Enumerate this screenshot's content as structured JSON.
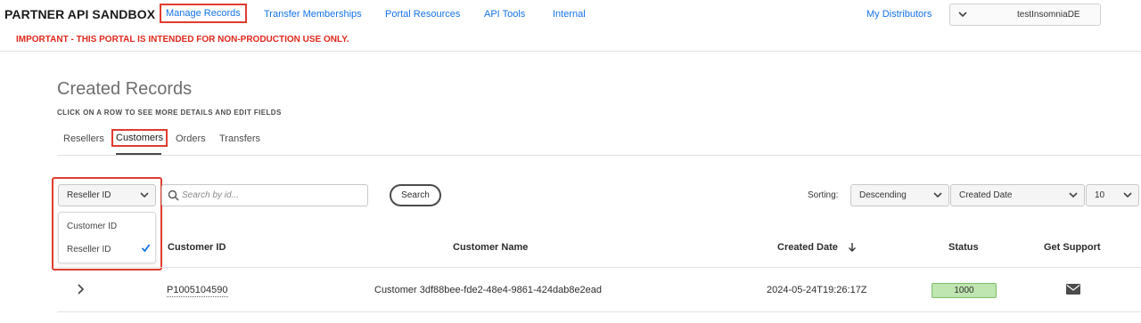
{
  "header": {
    "brand": "PARTNER API SANDBOX",
    "nav": [
      "Manage Records",
      "Transfer Memberships",
      "Portal Resources",
      "API Tools",
      "Internal"
    ],
    "my_distributors": "My Distributors",
    "distributor_value": "testInsomniaDE",
    "warning": "IMPORTANT - THIS PORTAL IS INTENDED FOR NON-PRODUCTION USE ONLY."
  },
  "page": {
    "title": "Created Records",
    "subtitle": "CLICK ON A ROW TO SEE MORE DETAILS AND EDIT FIELDS"
  },
  "tabs": [
    "Resellers",
    "Customers",
    "Orders",
    "Transfers"
  ],
  "active_tab": "Customers",
  "filter": {
    "selected": "Reseller ID",
    "options": [
      "Customer ID",
      "Reseller ID"
    ],
    "search_placeholder": "Search by id...",
    "search_button": "Search"
  },
  "sorting": {
    "label": "Sorting:",
    "direction": "Descending",
    "field": "Created Date",
    "page_size": "10"
  },
  "table": {
    "columns": [
      "Customer ID",
      "Customer Name",
      "Created Date",
      "Status",
      "Get Support"
    ],
    "rows": [
      {
        "customer_id": "P1005104590",
        "customer_name": "Customer 3df88bee-fde2-48e4-9861-424dab8e2ead",
        "created_date": "2024-05-24T19:26:17Z",
        "status": "1000"
      }
    ]
  },
  "colors": {
    "link": "#1473e6",
    "highlight": "#e03c2e",
    "warning": "#e0281c",
    "status_active": "#bfe5b0"
  },
  "icons": [
    "chevron-down-icon",
    "search-icon",
    "checkmark-icon",
    "sort-arrow-down-icon",
    "chevron-right-icon",
    "mail-icon"
  ]
}
